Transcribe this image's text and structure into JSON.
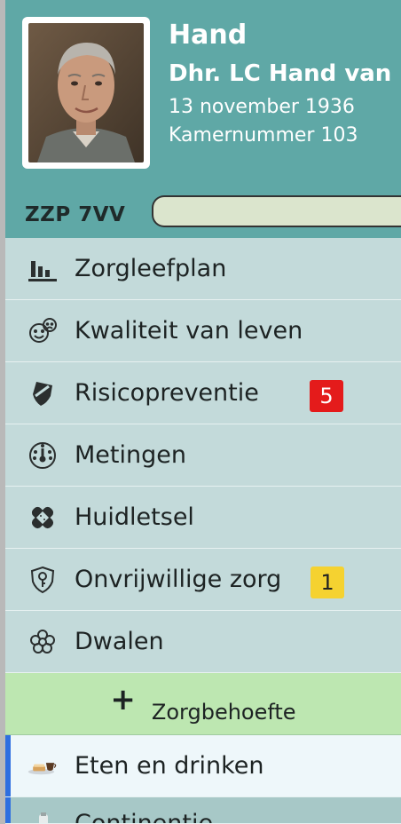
{
  "patient": {
    "lastname": "Hand",
    "fullname": "Dhr. LC Hand van",
    "birthdate": "13 november 1936",
    "room": "Kamernummer 103"
  },
  "zzp": {
    "label": "ZZP 7VV"
  },
  "menu": {
    "items": [
      {
        "label": "Zorgleefplan",
        "icon": "bar-chart-icon"
      },
      {
        "label": "Kwaliteit van leven",
        "icon": "smiley-faces-icon"
      },
      {
        "label": "Risicopreventie",
        "icon": "shield-icon",
        "badge": "5"
      },
      {
        "label": "Metingen",
        "icon": "gauge-icon"
      },
      {
        "label": "Huidletsel",
        "icon": "bandage-icon"
      },
      {
        "label": "Onvrijwillige zorg",
        "icon": "shield-key-icon",
        "badge": "1"
      },
      {
        "label": "Dwalen",
        "icon": "flower-icon"
      }
    ],
    "add_button": {
      "label": "Zorgbehoefte",
      "icon": "plus-icon"
    },
    "care_items": [
      {
        "label": "Eten en drinken",
        "icon": "food-icon"
      },
      {
        "label": "Continentie",
        "icon": "bottle-icon"
      }
    ]
  },
  "colors": {
    "header": "#5fa8a6",
    "menu_bg": "#c3dada",
    "badge_red": "#e41b1b",
    "badge_yellow": "#f5d230",
    "add_button": "#bde7b1",
    "selected_bar": "#2f6fe0"
  }
}
